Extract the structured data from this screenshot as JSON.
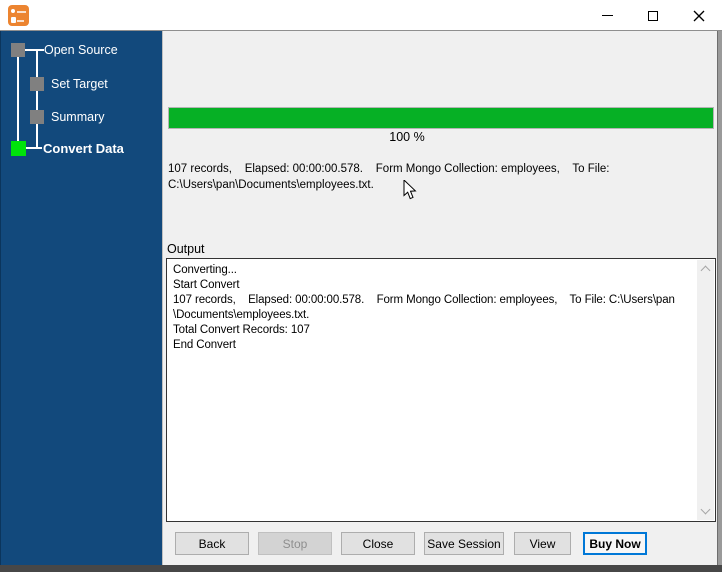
{
  "titlebar": {
    "icons": [
      "app-icon",
      "minimize-icon",
      "maximize-icon",
      "close-icon"
    ]
  },
  "sidebar": {
    "steps": [
      {
        "label": "Open Source",
        "state": "done"
      },
      {
        "label": "Set Target",
        "state": "done"
      },
      {
        "label": "Summary",
        "state": "done"
      },
      {
        "label": "Convert Data",
        "state": "active"
      }
    ]
  },
  "main": {
    "progress": {
      "value": 100,
      "label": "100 %"
    },
    "status_text": "107 records,    Elapsed: 00:00:00.578.    Form Mongo Collection: employees,    To File:\nC:\\Users\\pan\\Documents\\employees.txt.",
    "output": {
      "label": "Output",
      "lines": [
        "Converting...",
        "Start Convert",
        "107 records,    Elapsed: 00:00:00.578.    Form Mongo Collection: employees,    To File: C:\\Users\\pan\\Documents\\employees.txt.",
        "Total Convert Records: 107",
        "End Convert"
      ]
    },
    "buttons": [
      {
        "label": "Back",
        "enabled": true
      },
      {
        "label": "Stop",
        "enabled": false
      },
      {
        "label": "Close",
        "enabled": true
      },
      {
        "label": "Save Session",
        "enabled": true
      },
      {
        "label": "View",
        "enabled": true
      },
      {
        "label": "Buy Now",
        "enabled": true,
        "default": true
      }
    ]
  },
  "colors": {
    "sidebar_blue": "#12497c",
    "progress_green": "#06b025",
    "step_done_gray": "#808080",
    "step_active_green": "#00e40a",
    "default_button_border": "#0078d7"
  }
}
